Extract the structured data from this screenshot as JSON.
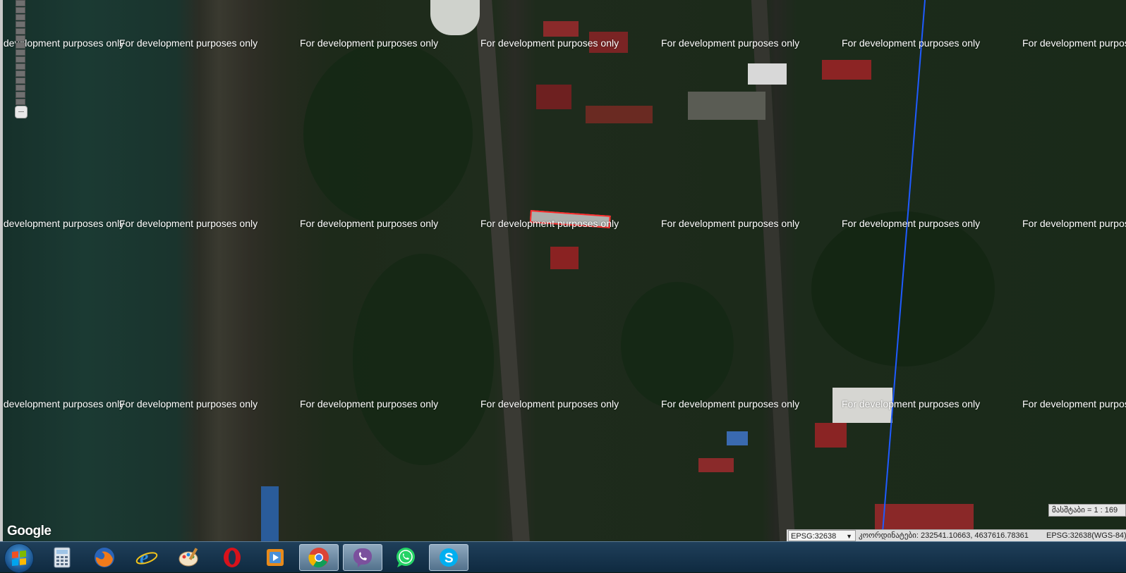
{
  "map": {
    "watermark_text": "For development purposes only",
    "google_logo": "Google",
    "scale_text": "მასშტაბი = 1 : 169",
    "projection_select": "EPSG:32638",
    "coordinates_text": "კოორდინატები: 232541.10663, 4637616.78361",
    "projection_text": "EPSG:32638(WGS-84)",
    "highlight_color": "#ff2a2a",
    "line_color": "#1f5bff"
  },
  "taskbar": {
    "start_label": "Start",
    "apps": [
      {
        "icon": "calculator-icon",
        "label": "Calculator"
      },
      {
        "icon": "firefox-icon",
        "label": "Firefox"
      },
      {
        "icon": "internet-explorer-icon",
        "label": "Internet Explorer"
      },
      {
        "icon": "paint-icon",
        "label": "Paint"
      },
      {
        "icon": "opera-icon",
        "label": "Opera"
      },
      {
        "icon": "media-player-icon",
        "label": "Media Player"
      },
      {
        "icon": "chrome-icon",
        "label": "Chrome"
      },
      {
        "icon": "viber-icon",
        "label": "Viber"
      },
      {
        "icon": "whatsapp-icon",
        "label": "WhatsApp"
      },
      {
        "icon": "skype-icon",
        "label": "Skype"
      }
    ]
  }
}
